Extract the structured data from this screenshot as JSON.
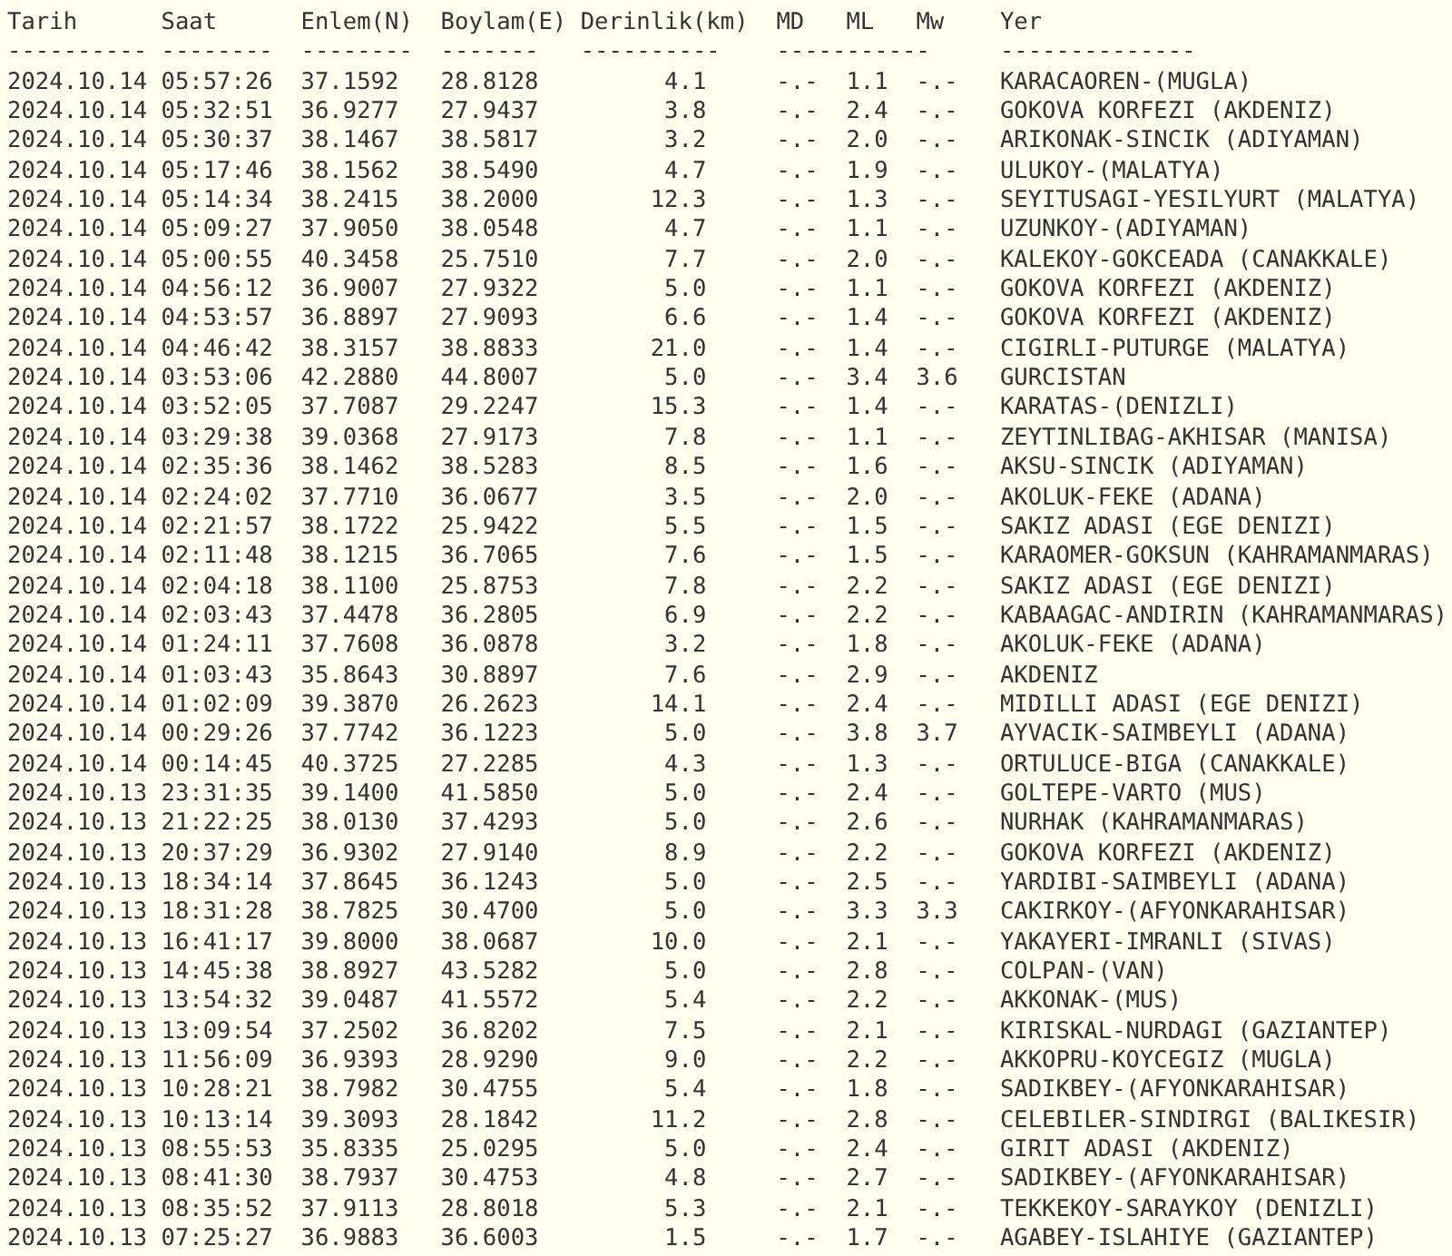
{
  "columns": [
    "Tarih",
    "Saat",
    "Enlem(N)",
    "Boylam(E)",
    "Derinlik(km)",
    "MD",
    "ML",
    "Mw",
    "Yer"
  ],
  "separators": [
    "----------",
    "--------",
    "--------",
    "-------",
    "----------",
    "-----------",
    "--------------"
  ],
  "rows": [
    [
      "2024.10.14",
      "05:57:26",
      "37.1592",
      "28.8128",
      "4.1",
      "-.-",
      "1.1",
      "-.-",
      "KARACAOREN-(MUGLA)"
    ],
    [
      "2024.10.14",
      "05:32:51",
      "36.9277",
      "27.9437",
      "3.8",
      "-.-",
      "2.4",
      "-.-",
      "GOKOVA KORFEZI (AKDENIZ)"
    ],
    [
      "2024.10.14",
      "05:30:37",
      "38.1467",
      "38.5817",
      "3.2",
      "-.-",
      "2.0",
      "-.-",
      "ARIKONAK-SINCIK (ADIYAMAN)"
    ],
    [
      "2024.10.14",
      "05:17:46",
      "38.1562",
      "38.5490",
      "4.7",
      "-.-",
      "1.9",
      "-.-",
      "ULUKOY-(MALATYA)"
    ],
    [
      "2024.10.14",
      "05:14:34",
      "38.2415",
      "38.2000",
      "12.3",
      "-.-",
      "1.3",
      "-.-",
      "SEYITUSAGI-YESILYURT (MALATYA)"
    ],
    [
      "2024.10.14",
      "05:09:27",
      "37.9050",
      "38.0548",
      "4.7",
      "-.-",
      "1.1",
      "-.-",
      "UZUNKOY-(ADIYAMAN)"
    ],
    [
      "2024.10.14",
      "05:00:55",
      "40.3458",
      "25.7510",
      "7.7",
      "-.-",
      "2.0",
      "-.-",
      "KALEKOY-GOKCEADA (CANAKKALE)"
    ],
    [
      "2024.10.14",
      "04:56:12",
      "36.9007",
      "27.9322",
      "5.0",
      "-.-",
      "1.1",
      "-.-",
      "GOKOVA KORFEZI (AKDENIZ)"
    ],
    [
      "2024.10.14",
      "04:53:57",
      "36.8897",
      "27.9093",
      "6.6",
      "-.-",
      "1.4",
      "-.-",
      "GOKOVA KORFEZI (AKDENIZ)"
    ],
    [
      "2024.10.14",
      "04:46:42",
      "38.3157",
      "38.8833",
      "21.0",
      "-.-",
      "1.4",
      "-.-",
      "CIGIRLI-PUTURGE (MALATYA)"
    ],
    [
      "2024.10.14",
      "03:53:06",
      "42.2880",
      "44.8007",
      "5.0",
      "-.-",
      "3.4",
      "3.6",
      "GURCISTAN"
    ],
    [
      "2024.10.14",
      "03:52:05",
      "37.7087",
      "29.2247",
      "15.3",
      "-.-",
      "1.4",
      "-.-",
      "KARATAS-(DENIZLI)"
    ],
    [
      "2024.10.14",
      "03:29:38",
      "39.0368",
      "27.9173",
      "7.8",
      "-.-",
      "1.1",
      "-.-",
      "ZEYTINLIBAG-AKHISAR (MANISA)"
    ],
    [
      "2024.10.14",
      "02:35:36",
      "38.1462",
      "38.5283",
      "8.5",
      "-.-",
      "1.6",
      "-.-",
      "AKSU-SINCIK (ADIYAMAN)"
    ],
    [
      "2024.10.14",
      "02:24:02",
      "37.7710",
      "36.0677",
      "3.5",
      "-.-",
      "2.0",
      "-.-",
      "AKOLUK-FEKE (ADANA)"
    ],
    [
      "2024.10.14",
      "02:21:57",
      "38.1722",
      "25.9422",
      "5.5",
      "-.-",
      "1.5",
      "-.-",
      "SAKIZ ADASI (EGE DENIZI)"
    ],
    [
      "2024.10.14",
      "02:11:48",
      "38.1215",
      "36.7065",
      "7.6",
      "-.-",
      "1.5",
      "-.-",
      "KARAOMER-GOKSUN (KAHRAMANMARAS)"
    ],
    [
      "2024.10.14",
      "02:04:18",
      "38.1100",
      "25.8753",
      "7.8",
      "-.-",
      "2.2",
      "-.-",
      "SAKIZ ADASI (EGE DENIZI)"
    ],
    [
      "2024.10.14",
      "02:03:43",
      "37.4478",
      "36.2805",
      "6.9",
      "-.-",
      "2.2",
      "-.-",
      "KABAAGAC-ANDIRIN (KAHRAMANMARAS)"
    ],
    [
      "2024.10.14",
      "01:24:11",
      "37.7608",
      "36.0878",
      "3.2",
      "-.-",
      "1.8",
      "-.-",
      "AKOLUK-FEKE (ADANA)"
    ],
    [
      "2024.10.14",
      "01:03:43",
      "35.8643",
      "30.8897",
      "7.6",
      "-.-",
      "2.9",
      "-.-",
      "AKDENIZ"
    ],
    [
      "2024.10.14",
      "01:02:09",
      "39.3870",
      "26.2623",
      "14.1",
      "-.-",
      "2.4",
      "-.-",
      "MIDILLI ADASI (EGE DENIZI)"
    ],
    [
      "2024.10.14",
      "00:29:26",
      "37.7742",
      "36.1223",
      "5.0",
      "-.-",
      "3.8",
      "3.7",
      "AYVACIK-SAIMBEYLI (ADANA)"
    ],
    [
      "2024.10.14",
      "00:14:45",
      "40.3725",
      "27.2285",
      "4.3",
      "-.-",
      "1.3",
      "-.-",
      "ORTULUCE-BIGA (CANAKKALE)"
    ],
    [
      "2024.10.13",
      "23:31:35",
      "39.1400",
      "41.5850",
      "5.0",
      "-.-",
      "2.4",
      "-.-",
      "GOLTEPE-VARTO (MUS)"
    ],
    [
      "2024.10.13",
      "21:22:25",
      "38.0130",
      "37.4293",
      "5.0",
      "-.-",
      "2.6",
      "-.-",
      "NURHAK (KAHRAMANMARAS)"
    ],
    [
      "2024.10.13",
      "20:37:29",
      "36.9302",
      "27.9140",
      "8.9",
      "-.-",
      "2.2",
      "-.-",
      "GOKOVA KORFEZI (AKDENIZ)"
    ],
    [
      "2024.10.13",
      "18:34:14",
      "37.8645",
      "36.1243",
      "5.0",
      "-.-",
      "2.5",
      "-.-",
      "YARDIBI-SAIMBEYLI (ADANA)"
    ],
    [
      "2024.10.13",
      "18:31:28",
      "38.7825",
      "30.4700",
      "5.0",
      "-.-",
      "3.3",
      "3.3",
      "CAKIRKOY-(AFYONKARAHISAR)"
    ],
    [
      "2024.10.13",
      "16:41:17",
      "39.8000",
      "38.0687",
      "10.0",
      "-.-",
      "2.1",
      "-.-",
      "YAKAYERI-IMRANLI (SIVAS)"
    ],
    [
      "2024.10.13",
      "14:45:38",
      "38.8927",
      "43.5282",
      "5.0",
      "-.-",
      "2.8",
      "-.-",
      "COLPAN-(VAN)"
    ],
    [
      "2024.10.13",
      "13:54:32",
      "39.0487",
      "41.5572",
      "5.4",
      "-.-",
      "2.2",
      "-.-",
      "AKKONAK-(MUS)"
    ],
    [
      "2024.10.13",
      "13:09:54",
      "37.2502",
      "36.8202",
      "7.5",
      "-.-",
      "2.1",
      "-.-",
      "KIRISKAL-NURDAGI (GAZIANTEP)"
    ],
    [
      "2024.10.13",
      "11:56:09",
      "36.9393",
      "28.9290",
      "9.0",
      "-.-",
      "2.2",
      "-.-",
      "AKKOPRU-KOYCEGIZ (MUGLA)"
    ],
    [
      "2024.10.13",
      "10:28:21",
      "38.7982",
      "30.4755",
      "5.4",
      "-.-",
      "1.8",
      "-.-",
      "SADIKBEY-(AFYONKARAHISAR)"
    ],
    [
      "2024.10.13",
      "10:13:14",
      "39.3093",
      "28.1842",
      "11.2",
      "-.-",
      "2.8",
      "-.-",
      "CELEBILER-SINDIRGI (BALIKESIR)"
    ],
    [
      "2024.10.13",
      "08:55:53",
      "35.8335",
      "25.0295",
      "5.0",
      "-.-",
      "2.4",
      "-.-",
      "GIRIT ADASI (AKDENIZ)"
    ],
    [
      "2024.10.13",
      "08:41:30",
      "38.7937",
      "30.4753",
      "4.8",
      "-.-",
      "2.7",
      "-.-",
      "SADIKBEY-(AFYONKARAHISAR)"
    ],
    [
      "2024.10.13",
      "08:35:52",
      "37.9113",
      "28.8018",
      "5.3",
      "-.-",
      "2.1",
      "-.-",
      "TEKKEKOY-SARAYKOY (DENIZLI)"
    ],
    [
      "2024.10.13",
      "07:25:27",
      "36.9883",
      "36.6003",
      "1.5",
      "-.-",
      "1.7",
      "-.-",
      "AGABEY-ISLAHIYE (GAZIANTEP)"
    ]
  ]
}
